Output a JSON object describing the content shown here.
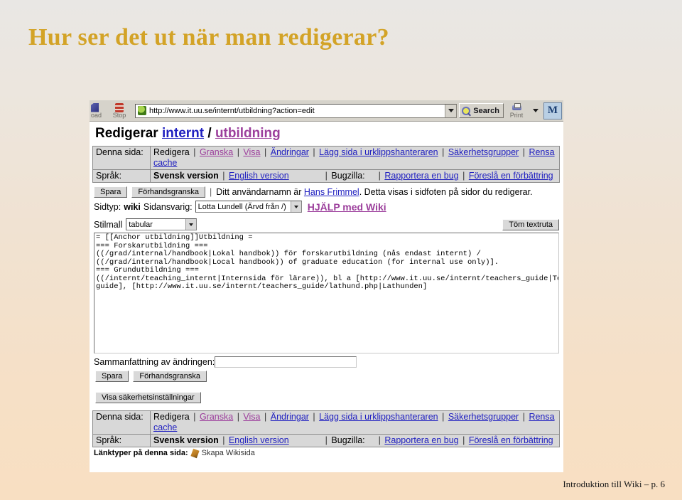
{
  "slide": {
    "title": "Hur ser det ut när man redigerar?",
    "footer": "Introduktion till Wiki – p. 6",
    "title_color": "#d3a327"
  },
  "browser": {
    "reload_label": "oad",
    "stop_label": "Stop",
    "url": "http://www.it.uu.se/internt/utbildning?action=edit",
    "search_label": "Search",
    "print_label": "Print",
    "logo_label": "M",
    "icons": {
      "reload": "reload-icon",
      "stop": "stop-icon",
      "site": "site-favicon",
      "url_dropdown": "chevron-down-icon",
      "search": "magnifier-icon",
      "print": "printer-icon",
      "print_dropdown": "chevron-down-icon",
      "brand": "mozilla-logo-icon"
    }
  },
  "page": {
    "heading_prefix": "Redigerar ",
    "heading_link1": "internt",
    "heading_sep": " / ",
    "heading_link2": "utbildning",
    "navbar": {
      "row1_label": "Denna sida:",
      "row1_items": [
        "Redigera",
        "Granska",
        "Visa",
        "Ändringar",
        "Lägg sida i urklippshanteraren",
        "Säkerhetsgrupper",
        "Rensa cache"
      ],
      "row2_label": "Språk:",
      "lang_current": "Svensk version",
      "lang_other": "English version",
      "bugzilla_label": "Bugzilla:",
      "bug_report": "Rapportera en bug",
      "bug_suggest": "Föreslå en förbättring"
    },
    "edit": {
      "save_label": "Spara",
      "preview_label": "Förhandsgranska",
      "username_prefix": "Ditt användarnamn är ",
      "username": "Hans Frimmel",
      "username_suffix": ". Detta visas i sidfoten på sidor du redigerar.",
      "pagetype_label": "Sidtyp:",
      "pagetype_value": "wiki",
      "owner_label": "Sidansvarig:",
      "owner_value": "Lotta Lundell (Ärvd från /)",
      "help_link": "HJÄLP med Wiki"
    },
    "stylesheet": {
      "label": "Stilmall",
      "value": "tabular",
      "clear_label": "Töm textruta"
    },
    "textarea_content": "= [[Anchor utbildning]]Utbildning =\n=== Forskarutbildning ===\n((/grad/internal/handbook|Lokal handbok)) för forskarutbildning (nås endast internt) /\n((/grad/internal/handbook|Local handbook)) of graduate education (for internal use only)].\n=== Grundutbildning ===\n((/internt/teaching_internt|Internsida för lärare)), bl a [http://www.it.uu.se/internt/teachers_guide|Teacher's\nguide], [http://www.it.uu.se/internt/teachers_guide/lathund.php|Lathunden]",
    "summary": {
      "label": "Sammanfattning av ändringen:",
      "value": "",
      "placeholder": ""
    },
    "bottom_buttons": {
      "save_label": "Spara",
      "preview_label": "Förhandsgranska"
    },
    "security_button": "Visa säkerhetsinställningar",
    "footer_links": {
      "label": "Länktyper på denna sida:",
      "item": "Skapa Wikisida",
      "icon": "pencil-icon"
    }
  }
}
